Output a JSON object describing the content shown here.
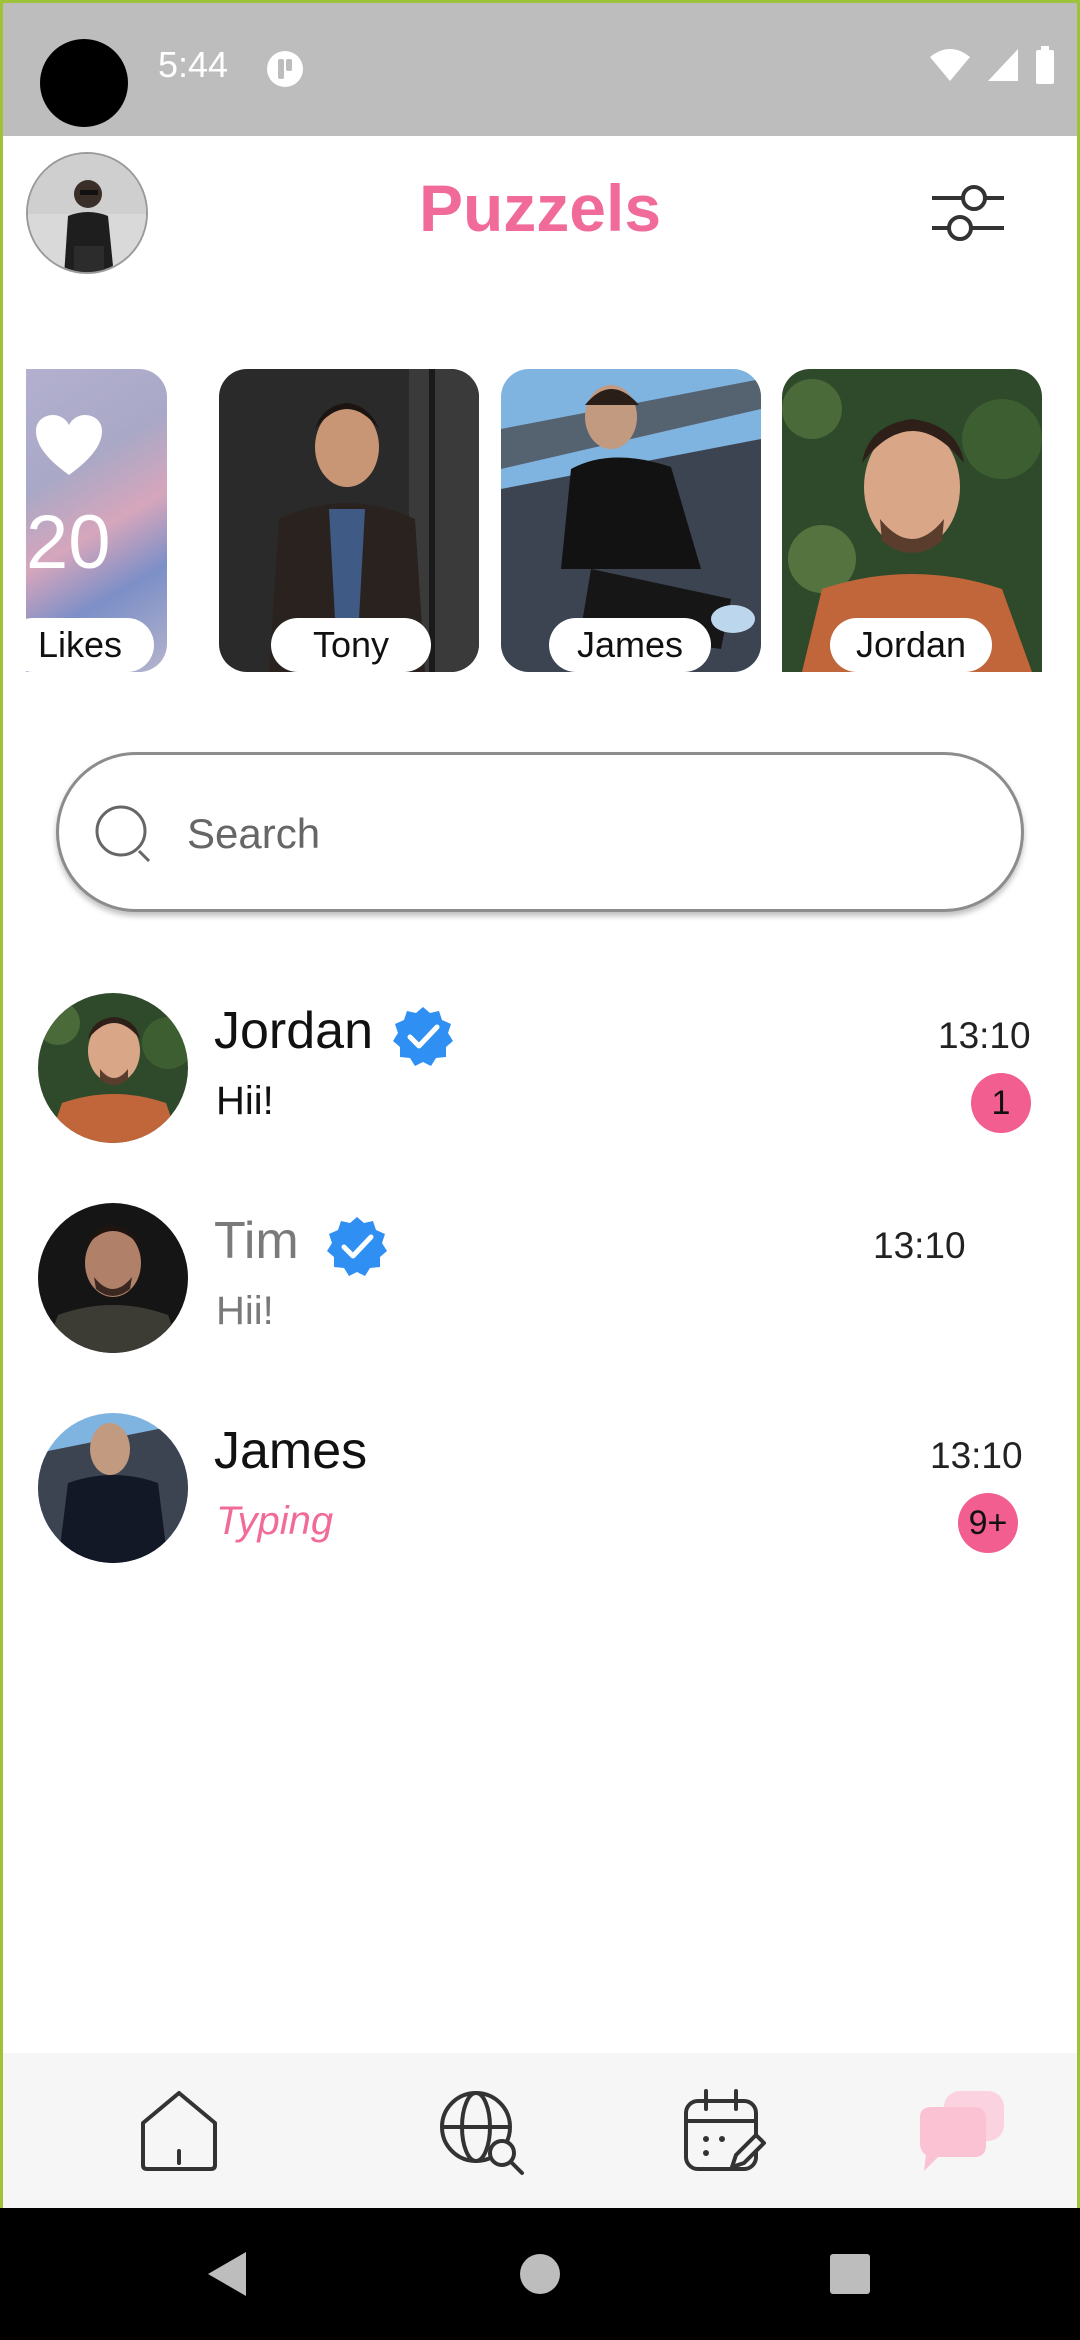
{
  "status_bar": {
    "time": "5:44"
  },
  "header": {
    "title": "Puzzels",
    "title_color": "#f06b9a"
  },
  "stories": {
    "likes": {
      "count": "20",
      "label": "Likes"
    },
    "items": [
      {
        "name": "Tony"
      },
      {
        "name": "James"
      },
      {
        "name": "Jordan"
      }
    ]
  },
  "search": {
    "placeholder": "Search"
  },
  "chats": [
    {
      "name": "Jordan",
      "verified": true,
      "message": "Hii!",
      "time": "13:10",
      "unread": "1",
      "style": "normal"
    },
    {
      "name": "Tim",
      "verified": true,
      "message": "Hii!",
      "time": "13:10",
      "unread": null,
      "style": "muted"
    },
    {
      "name": "James",
      "verified": false,
      "message": "Typing",
      "time": "13:10",
      "unread": "9+",
      "style": "typing"
    }
  ],
  "bottom_nav": {
    "items": [
      {
        "icon": "home-icon"
      },
      {
        "icon": "globe-search-icon"
      },
      {
        "icon": "calendar-edit-icon"
      },
      {
        "icon": "chat-bubbles-icon",
        "active": true
      }
    ],
    "active_color": "#fbd3e0"
  },
  "colors": {
    "accent": "#f06b9a",
    "badge": "#f25e8f",
    "verified": "#2f8ff2"
  }
}
